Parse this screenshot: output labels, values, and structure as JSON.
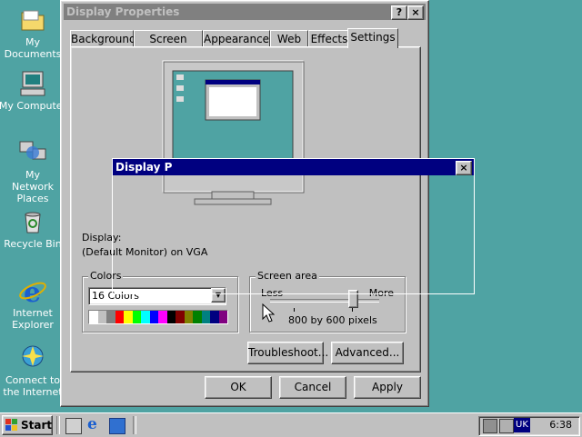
{
  "desktop": {
    "icons": [
      {
        "label": "My Documents"
      },
      {
        "label": "My Computer"
      },
      {
        "label": "My Network Places"
      },
      {
        "label": "Recycle Bin"
      },
      {
        "label": "Internet Explorer"
      },
      {
        "label": "Connect to the Internet"
      }
    ]
  },
  "window": {
    "title": "Display Properties",
    "help_btn": "?",
    "close_btn": "×",
    "tabs": [
      {
        "label": "Background"
      },
      {
        "label": "Screen Saver"
      },
      {
        "label": "Appearance"
      },
      {
        "label": "Web"
      },
      {
        "label": "Effects"
      },
      {
        "label": "Settings"
      }
    ],
    "display_label": "Display:",
    "display_value": "(Default Monitor) on VGA",
    "colors_group": "Colors",
    "colors_value": "16 Colors",
    "screen_area_group": "Screen area",
    "less": "Less",
    "more": "More",
    "resolution": "800 by 600 pixels",
    "troubleshoot": "Troubleshoot...",
    "advanced": "Advanced...",
    "ok": "OK",
    "cancel": "Cancel",
    "apply": "Apply"
  },
  "ghost_window": {
    "title": "Display P",
    "close_btn": "×"
  },
  "taskbar": {
    "start": "Start",
    "lang": "UK",
    "clock": "6:38"
  },
  "colors": {
    "desktop": "#4fa3a3",
    "face": "#c0c0c0",
    "title_active": "#000080",
    "title_inactive": "#808080"
  }
}
